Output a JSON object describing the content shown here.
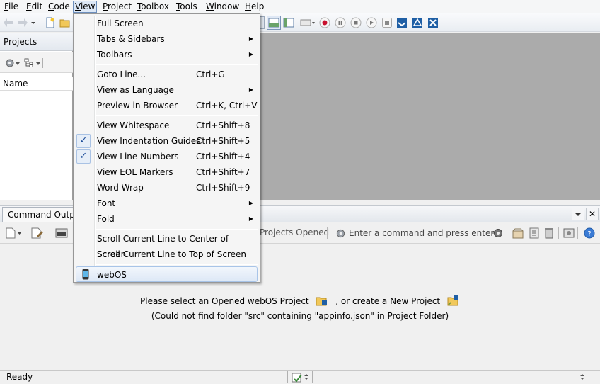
{
  "menubar": {
    "items": [
      {
        "label": "File",
        "mnemonic": "F",
        "rest": "ile"
      },
      {
        "label": "Edit",
        "mnemonic": "E",
        "rest": "dit"
      },
      {
        "label": "Code",
        "mnemonic": "C",
        "rest": "ode"
      },
      {
        "label": "View",
        "mnemonic": "V",
        "rest": "iew"
      },
      {
        "label": "Project",
        "mnemonic": "P",
        "rest": "roject"
      },
      {
        "label": "Toolbox",
        "mnemonic": "T",
        "rest": "oolbox"
      },
      {
        "label": "Tools",
        "mnemonic": "T",
        "rest": "ools"
      },
      {
        "label": "Window",
        "mnemonic": "W",
        "rest": "indow"
      },
      {
        "label": "Help",
        "mnemonic": "H",
        "rest": "elp"
      }
    ]
  },
  "left_pane": {
    "title": "Projects",
    "column_header": "Name"
  },
  "bottom_panel": {
    "tab_label": "Command Output",
    "projects_opened": "Projects Opened",
    "command_placeholder": "Enter a command and press enter",
    "message_line1_a": "Please select an Opened webOS Project",
    "message_line1_b": ", or create a New Project",
    "message_line2": "(Could not find folder \"src\" containing \"appinfo.json\" in Project Folder)"
  },
  "statusbar": {
    "text": "Ready"
  },
  "view_menu": {
    "items": [
      {
        "label": "Full Screen",
        "shortcut": "",
        "submenu": false,
        "checked": false
      },
      {
        "label": "Tabs & Sidebars",
        "shortcut": "",
        "submenu": true,
        "checked": false
      },
      {
        "label": "Toolbars",
        "shortcut": "",
        "submenu": true,
        "checked": false
      },
      {
        "label": "Goto Line...",
        "shortcut": "Ctrl+G",
        "submenu": false,
        "checked": false
      },
      {
        "label": "View as Language",
        "shortcut": "",
        "submenu": true,
        "checked": false
      },
      {
        "label": "Preview in Browser",
        "shortcut": "Ctrl+K, Ctrl+V",
        "submenu": false,
        "checked": false
      },
      {
        "label": "View Whitespace",
        "shortcut": "Ctrl+Shift+8",
        "submenu": false,
        "checked": false
      },
      {
        "label": "View Indentation Guides",
        "shortcut": "Ctrl+Shift+5",
        "submenu": false,
        "checked": true
      },
      {
        "label": "View Line Numbers",
        "shortcut": "Ctrl+Shift+4",
        "submenu": false,
        "checked": true
      },
      {
        "label": "View EOL Markers",
        "shortcut": "Ctrl+Shift+7",
        "submenu": false,
        "checked": false
      },
      {
        "label": "Word Wrap",
        "shortcut": "Ctrl+Shift+9",
        "submenu": false,
        "checked": false
      },
      {
        "label": "Font",
        "shortcut": "",
        "submenu": true,
        "checked": false
      },
      {
        "label": "Fold",
        "shortcut": "",
        "submenu": true,
        "checked": false
      },
      {
        "label": "Scroll Current Line to Center of Screen",
        "shortcut": "",
        "submenu": false,
        "checked": false
      },
      {
        "label": "Scroll Current Line to Top of Screen",
        "shortcut": "",
        "submenu": false,
        "checked": false
      },
      {
        "label": "webOS",
        "shortcut": "",
        "submenu": false,
        "checked": false,
        "highlighted": true
      }
    ]
  },
  "icons": {
    "submenu_arrow": "triangle-right-icon",
    "check": "check-icon"
  },
  "colors": {
    "editor_bg": "#ababab",
    "menu_highlight_border": "#a8c4e8",
    "check_color": "#1f4f9b"
  }
}
